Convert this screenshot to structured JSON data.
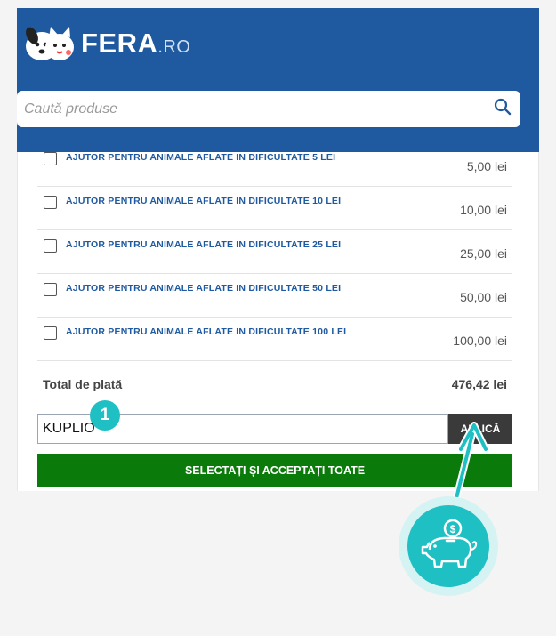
{
  "brand": {
    "name": "FERA",
    "tld": ".RO"
  },
  "search": {
    "placeholder": "Caută produse",
    "icon": "search-icon"
  },
  "donations": [
    {
      "label": "AJUTOR PENTRU ANIMALE AFLATE IN DIFICULTATE 5 LEI",
      "price": "5,00 lei",
      "checked": false
    },
    {
      "label": "AJUTOR PENTRU ANIMALE AFLATE IN DIFICULTATE 10 LEI",
      "price": "10,00 lei",
      "checked": false
    },
    {
      "label": "AJUTOR PENTRU ANIMALE AFLATE IN DIFICULTATE 25 LEI",
      "price": "25,00 lei",
      "checked": false
    },
    {
      "label": "AJUTOR PENTRU ANIMALE AFLATE IN DIFICULTATE 50 LEI",
      "price": "50,00 lei",
      "checked": false
    },
    {
      "label": "AJUTOR PENTRU ANIMALE AFLATE IN DIFICULTATE 100 LEI",
      "price": "100,00 lei",
      "checked": false
    }
  ],
  "total": {
    "label": "Total de plată",
    "value": "476,42 lei"
  },
  "coupon": {
    "value": "KUPLIO",
    "apply_label": "APLICĂ"
  },
  "accept_label": "SELECTAȚI ȘI ACCEPTAȚI TOATE",
  "step_badge": "1",
  "colors": {
    "header": "#1f5aa0",
    "accept": "#0a7a0a",
    "apply": "#3a3a3a",
    "accent": "#1ec0c4"
  },
  "icons": {
    "logo": "dog-cat-logo-icon",
    "piggy": "piggy-bank-coin-icon"
  }
}
